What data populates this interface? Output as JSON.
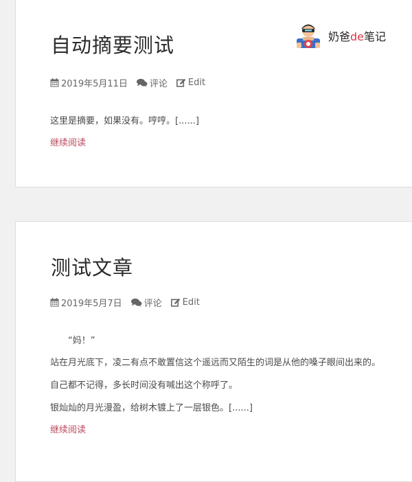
{
  "brand": {
    "name_pre": "奶爸",
    "name_hl": "de",
    "name_post": "笔记",
    "accent": "#d9384a"
  },
  "posts": [
    {
      "title": "自动摘要测试",
      "date": "2019年5月11日",
      "comments": "评论",
      "edit": "Edit",
      "paragraphs": [
        "这里是摘要，如果没有。哼哼。[......]"
      ],
      "more": "继续阅读"
    },
    {
      "title": "测试文章",
      "date": "2019年5月7日",
      "comments": "评论",
      "edit": "Edit",
      "paragraphs": [
        "“妈！”",
        "站在月光底下，凌二有点不敢置信这个遥远而又陌生的词是从他的嗓子眼间出来的。",
        "自己都不记得，多长时间没有喊出这个称呼了。",
        "银灿灿的月光漫盈，给树木镀上了一层银色。[......]"
      ],
      "more": "继续阅读"
    }
  ],
  "colors": {
    "link": "#b84a5c",
    "meta": "#666666",
    "card_bg": "#ffffff",
    "page_bg": "#f1f1f1"
  }
}
